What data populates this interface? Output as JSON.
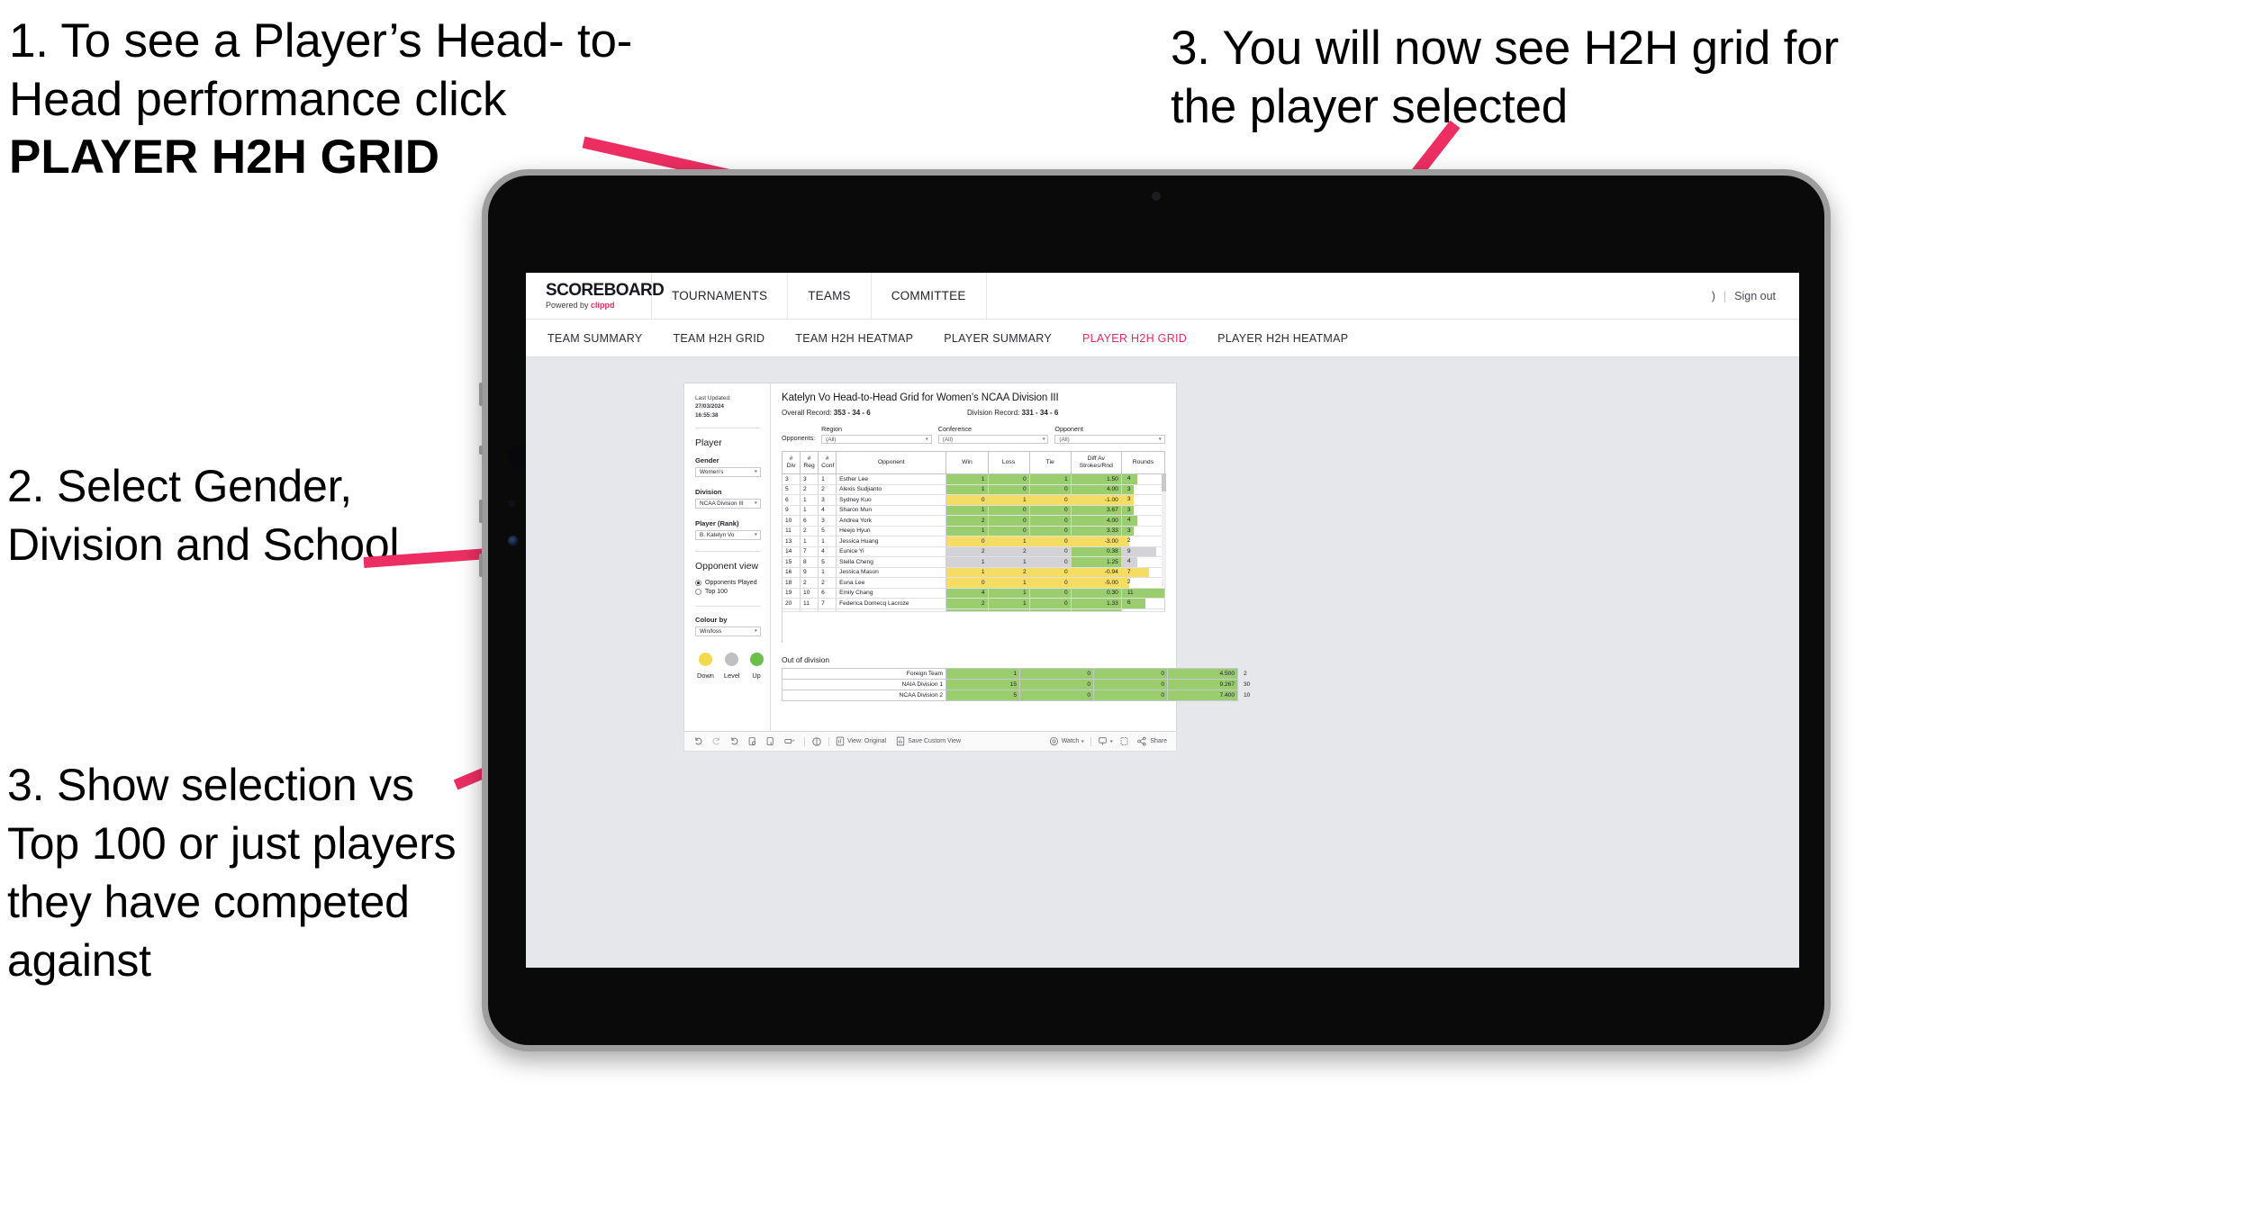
{
  "annotations": {
    "step1_line1": "1. To see a Player’s Head-",
    "step1_line2": "to-Head performance click ",
    "step1_bold": "PLAYER H2H GRID",
    "step2": "2. Select Gender, Division and School",
    "step3_left": "3. Show selection vs Top 100 or just players they have competed against",
    "step3_right": "3. You will now see H2H grid for the player selected",
    "arrow_color": "#ED2E63"
  },
  "app": {
    "brand": {
      "title": "SCOREBOARD",
      "powered_prefix": "Powered by ",
      "powered_name": "clippd"
    },
    "top_nav": [
      "TOURNAMENTS",
      "TEAMS",
      "COMMITTEE"
    ],
    "header_right": {
      "truncated": ")",
      "separator": "|",
      "sign_out": "Sign out"
    },
    "sub_nav": [
      {
        "label": "TEAM SUMMARY",
        "active": false
      },
      {
        "label": "TEAM H2H GRID",
        "active": false
      },
      {
        "label": "TEAM H2H HEATMAP",
        "active": false
      },
      {
        "label": "PLAYER SUMMARY",
        "active": false
      },
      {
        "label": "PLAYER H2H GRID",
        "active": true
      },
      {
        "label": "PLAYER H2H HEATMAP",
        "active": false
      }
    ],
    "active_color": "#ea2a5f"
  },
  "sidebar": {
    "last_updated_label": "Last Updated: ",
    "last_updated_date": "27/03/2024",
    "last_updated_time": "16:55:38",
    "player_heading": "Player",
    "gender_label": "Gender",
    "gender_value": "Women’s",
    "division_label": "Division",
    "division_value": "NCAA Division III",
    "player_rank_label": "Player (Rank)",
    "player_rank_value": "B. Katelyn Vo",
    "opponent_view_heading": "Opponent view",
    "opponent_view_options": [
      {
        "label": "Opponents Played",
        "selected": true
      },
      {
        "label": "Top 100",
        "selected": false
      }
    ],
    "colour_by_label": "Colour by",
    "colour_by_value": "Win/loss",
    "legend": [
      {
        "label": "Down",
        "color": "#F2D94E"
      },
      {
        "label": "Level",
        "color": "#BFBFC4"
      },
      {
        "label": "Up",
        "color": "#6CC04A"
      }
    ]
  },
  "main": {
    "title": "Katelyn Vo Head-to-Head Grid for Women’s NCAA Division III",
    "overall_record_label": "Overall Record: ",
    "overall_record_value": "353 - 34 - 6",
    "division_record_label": "Division Record: ",
    "division_record_value": "331 - 34 - 6",
    "opponents_label": "Opponents:",
    "filters": [
      {
        "label": "Region",
        "value": "(All)"
      },
      {
        "label": "Conference",
        "value": "(All)"
      },
      {
        "label": "Opponent",
        "value": "(All)"
      }
    ],
    "out_of_division_title": "Out of division"
  },
  "chart_data": {
    "type": "table",
    "title": "Katelyn Vo Head-to-Head Grid for Women’s NCAA Division III",
    "columns": [
      "# Div",
      "# Reg",
      "# Conf",
      "Opponent",
      "Win",
      "Loss",
      "Tie",
      "Diff Av Strokes/Rnd",
      "Rounds"
    ],
    "column_header_lines": [
      [
        "#",
        "Div"
      ],
      [
        "#",
        "Reg"
      ],
      [
        "#",
        "Conf"
      ],
      [
        "Opponent"
      ],
      [
        "Win"
      ],
      [
        "Loss"
      ],
      [
        "Tie"
      ],
      [
        "Diff Av",
        "Strokes/Rnd"
      ],
      [
        "Rounds"
      ]
    ],
    "rounds_max": 11,
    "colors": {
      "up": "#9ACD6E",
      "down": "#F5DC62",
      "level": "#D3D3D7"
    },
    "rows": [
      {
        "div": "3",
        "reg": "3",
        "conf": "1",
        "opponent": "Esther Lee",
        "win": "1",
        "loss": "0",
        "tie": "1",
        "diff": "1.50",
        "rounds": "4",
        "state": "up"
      },
      {
        "div": "5",
        "reg": "2",
        "conf": "2",
        "opponent": "Alexis Sudjianto",
        "win": "1",
        "loss": "0",
        "tie": "0",
        "diff": "4.00",
        "rounds": "3",
        "state": "up"
      },
      {
        "div": "6",
        "reg": "1",
        "conf": "3",
        "opponent": "Sydney Kuo",
        "win": "0",
        "loss": "1",
        "tie": "0",
        "diff": "-1.00",
        "rounds": "3",
        "state": "down"
      },
      {
        "div": "9",
        "reg": "1",
        "conf": "4",
        "opponent": "Sharon Mun",
        "win": "1",
        "loss": "0",
        "tie": "0",
        "diff": "3.67",
        "rounds": "3",
        "state": "up"
      },
      {
        "div": "10",
        "reg": "6",
        "conf": "3",
        "opponent": "Andrea York",
        "win": "2",
        "loss": "0",
        "tie": "0",
        "diff": "4.00",
        "rounds": "4",
        "state": "up"
      },
      {
        "div": "11",
        "reg": "2",
        "conf": "5",
        "opponent": "Heejo Hyun",
        "win": "1",
        "loss": "0",
        "tie": "0",
        "diff": "3.33",
        "rounds": "3",
        "state": "up"
      },
      {
        "div": "13",
        "reg": "1",
        "conf": "1",
        "opponent": "Jessica Huang",
        "win": "0",
        "loss": "1",
        "tie": "0",
        "diff": "-3.00",
        "rounds": "2",
        "state": "down"
      },
      {
        "div": "14",
        "reg": "7",
        "conf": "4",
        "opponent": "Eunice Yi",
        "win": "2",
        "loss": "2",
        "tie": "0",
        "diff": "0.38",
        "rounds": "9",
        "state": "level",
        "diff_state": "up"
      },
      {
        "div": "15",
        "reg": "8",
        "conf": "5",
        "opponent": "Stella Cheng",
        "win": "1",
        "loss": "1",
        "tie": "0",
        "diff": "1.25",
        "rounds": "4",
        "state": "level",
        "diff_state": "up"
      },
      {
        "div": "16",
        "reg": "9",
        "conf": "1",
        "opponent": "Jessica Mason",
        "win": "1",
        "loss": "2",
        "tie": "0",
        "diff": "-0.94",
        "rounds": "7",
        "state": "down"
      },
      {
        "div": "18",
        "reg": "2",
        "conf": "2",
        "opponent": "Euna Lee",
        "win": "0",
        "loss": "1",
        "tie": "0",
        "diff": "-5.00",
        "rounds": "2",
        "state": "down"
      },
      {
        "div": "19",
        "reg": "10",
        "conf": "6",
        "opponent": "Emily Chang",
        "win": "4",
        "loss": "1",
        "tie": "0",
        "diff": "0.30",
        "rounds": "11",
        "state": "up"
      },
      {
        "div": "20",
        "reg": "11",
        "conf": "7",
        "opponent": "Federica Domecq Lacroze",
        "win": "2",
        "loss": "1",
        "tie": "0",
        "diff": "1.33",
        "rounds": "6",
        "state": "up"
      }
    ],
    "out_of_division": {
      "rounds_max": 30,
      "rows": [
        {
          "name": "Foreign Team",
          "win": "1",
          "loss": "0",
          "tie": "0",
          "diff": "4.500",
          "rounds": "2",
          "state": "up"
        },
        {
          "name": "NAIA Division 1",
          "win": "15",
          "loss": "0",
          "tie": "0",
          "diff": "9.267",
          "rounds": "30",
          "state": "up"
        },
        {
          "name": "NCAA Division 2",
          "win": "5",
          "loss": "0",
          "tie": "0",
          "diff": "7.400",
          "rounds": "10",
          "state": "up"
        }
      ]
    }
  },
  "toolbar": {
    "view_label": "View: Original",
    "save_label": "Save Custom View",
    "watch_label": "Watch",
    "share_label": "Share"
  }
}
